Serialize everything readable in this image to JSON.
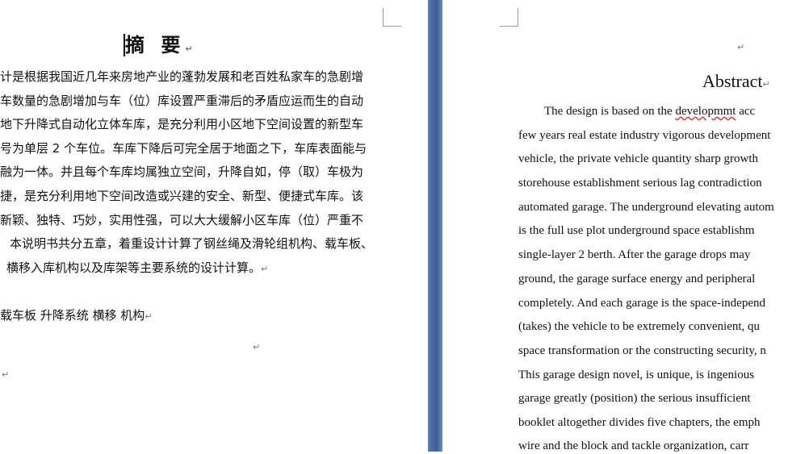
{
  "left_page": {
    "title": "摘 要",
    "lines": [
      "计是根据我国近几年来房地产业的蓬勃发展和老百姓私家车的急剧增",
      "车数量的急剧增加与车（位）库设置严重滞后的矛盾应运而生的自动",
      "地下升降式自动化立体车库，是充分利用小区地下空间设置的新型车",
      "号为单层 2 个车位。车库下降后可完全居于地面之下，车库表面能与",
      "融为一体。并且每个车库均属独立空间，升降自如，停（取）车极为",
      "捷，是充分利用地下空间改造或兴建的安全、新型、便捷式车库。该",
      "新颖、独特、巧妙，实用性强，可以大大缓解小区车库（位）严重不",
      "本说明书共分五章，着重设计计算了钢丝绳及滑轮组机构、载车板、",
      "横移入库机构以及库架等主要系统的设计计算。"
    ],
    "keywords": "载车板 升降系统 横移 机构"
  },
  "right_page": {
    "title": "Abstract",
    "first_line_before": "The design is based on the ",
    "first_line_misspelled": "developmmt",
    "first_line_after": "   acc",
    "lines": [
      "few years real estate industry vigorous development",
      "vehicle, the private vehicle quantity sharp growth",
      "storehouse establishment serious lag contradiction",
      "automated garage. The underground elevating autom",
      "is the full use plot underground space establishm",
      "single-layer 2 berth. After the garage drops may",
      "ground, the garage surface energy and peripheral",
      "completely. And each garage is the space-independ",
      "(takes) the vehicle to be extremely convenient, qu",
      "space transformation or the constructing security, n",
      "This garage design novel, is unique, is ingenious",
      "garage greatly (position) the serious insufficient",
      "booklet altogether divides five chapters, the emph",
      "wire and the block and tackle organization, carr"
    ]
  },
  "para_mark": "↵"
}
